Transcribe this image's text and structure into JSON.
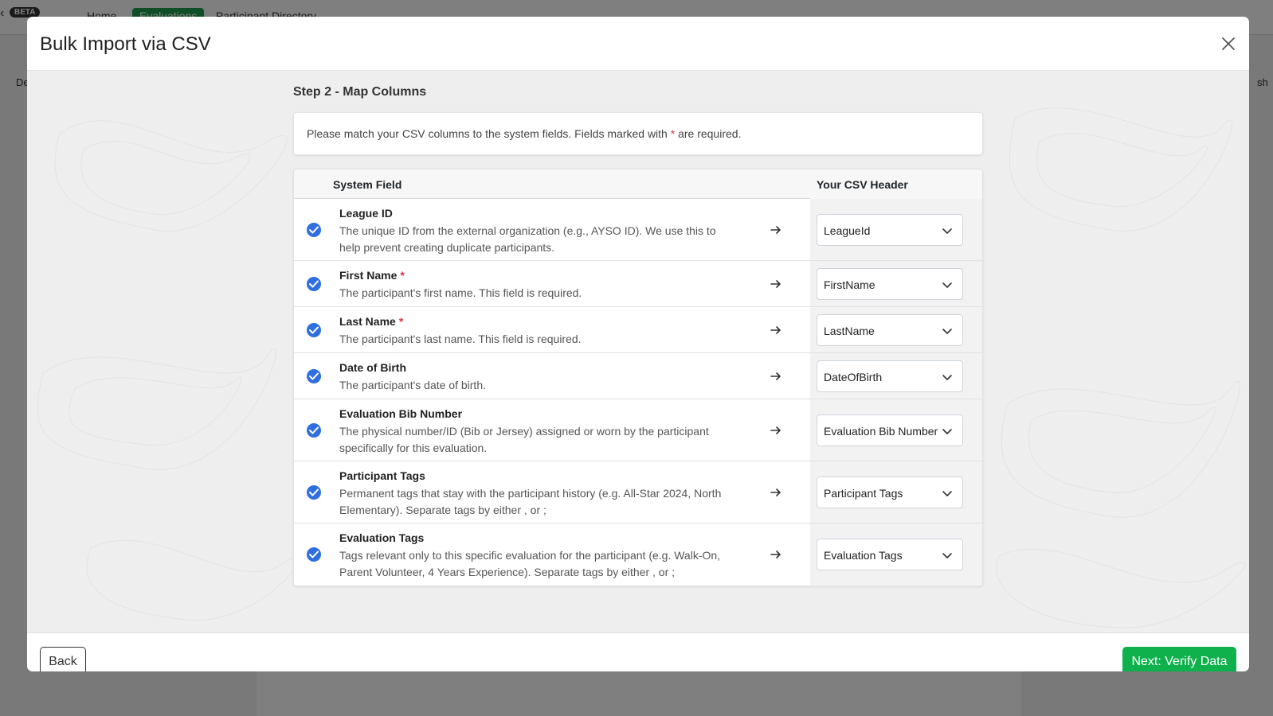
{
  "background": {
    "beta_label": "BETA",
    "nav": [
      "Home",
      "Evaluations",
      "Participant Directory"
    ],
    "sub_left": "De",
    "sub_right": "sh"
  },
  "modal": {
    "title": "Bulk Import via CSV",
    "step_title": "Step 2 - Map Columns",
    "info_text_before": "Please match your CSV columns to the system fields. Fields marked with ",
    "info_required_mark": "*",
    "info_text_after": " are required.",
    "table": {
      "col_system_field": "System Field",
      "col_csv_header": "Your CSV Header",
      "rows": [
        {
          "name": "League ID",
          "required": "",
          "desc": "The unique ID from the external organization (e.g., AYSO ID). We use this to help prevent creating duplicate participants.",
          "csv": "LeagueId"
        },
        {
          "name": "First Name",
          "required": "*",
          "desc": "The participant's first name. This field is required.",
          "csv": "FirstName"
        },
        {
          "name": "Last Name",
          "required": "*",
          "desc": "The participant's last name. This field is required.",
          "csv": "LastName"
        },
        {
          "name": "Date of Birth",
          "required": "",
          "desc": "The participant's date of birth.",
          "csv": "DateOfBirth"
        },
        {
          "name": "Evaluation Bib Number",
          "required": "",
          "desc": "The physical number/ID (Bib or Jersey) assigned or worn by the participant specifically for this evaluation.",
          "csv": "Evaluation Bib Number"
        },
        {
          "name": "Participant Tags",
          "required": "",
          "desc": "Permanent tags that stay with the participant history (e.g. All-Star 2024, North Elementary). Separate tags by either , or ;",
          "csv": "Participant Tags"
        },
        {
          "name": "Evaluation Tags",
          "required": "",
          "desc": "Tags relevant only to this specific evaluation for the participant (e.g. Walk-On, Parent Volunteer, 4 Years Experience). Separate tags by either , or ;",
          "csv": "Evaluation Tags"
        }
      ]
    },
    "back_label": "Back",
    "next_label": "Next: Verify Data"
  },
  "colors": {
    "accent_green": "#0fb14c",
    "check_blue": "#2f6fdf",
    "required_red": "#dc3545"
  },
  "icons": [
    "close-icon",
    "check-circle-icon",
    "arrow-right-icon",
    "chevron-down-icon"
  ]
}
